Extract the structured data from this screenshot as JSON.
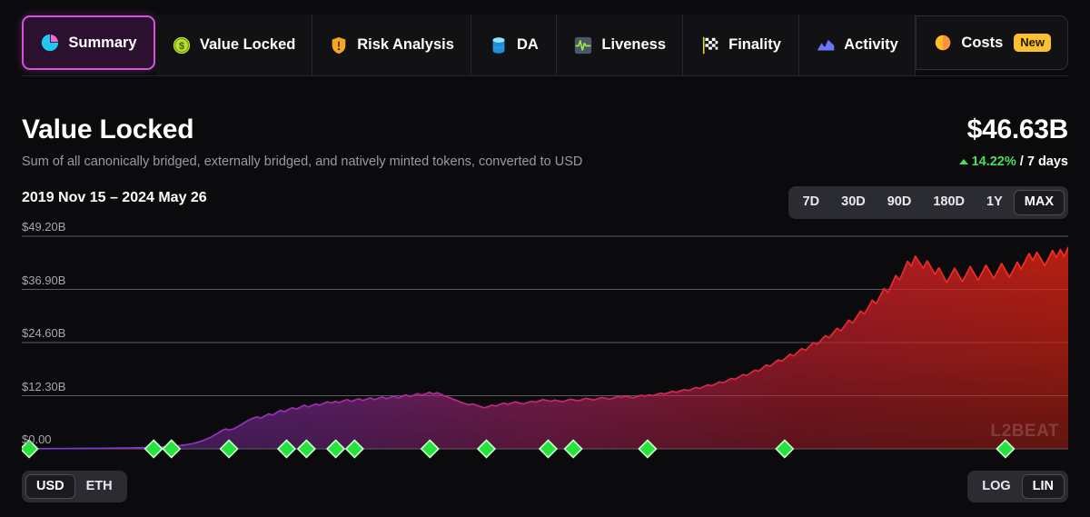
{
  "tabs": [
    {
      "label": "Summary",
      "icon": "pie-chart-icon",
      "active": true,
      "badge": null
    },
    {
      "label": "Value Locked",
      "icon": "dollar-coin-icon",
      "active": false,
      "badge": null
    },
    {
      "label": "Risk Analysis",
      "icon": "shield-warning-icon",
      "active": false,
      "badge": null
    },
    {
      "label": "DA",
      "icon": "database-icon",
      "active": false,
      "badge": null
    },
    {
      "label": "Liveness",
      "icon": "pulse-icon",
      "active": false,
      "badge": null
    },
    {
      "label": "Finality",
      "icon": "checkered-flag-icon",
      "active": false,
      "badge": null
    },
    {
      "label": "Activity",
      "icon": "area-chart-icon",
      "active": false,
      "badge": null
    },
    {
      "label": "Costs",
      "icon": "orange-circle-icon",
      "active": false,
      "badge": "New"
    }
  ],
  "header": {
    "title": "Value Locked",
    "subtitle": "Sum of all canonically bridged, externally bridged, and natively minted tokens, converted to USD",
    "value": "$46.63B",
    "change_pct": "14.22%",
    "change_period": "/ 7 days",
    "change_direction": "up",
    "change_color": "#4ade5c"
  },
  "controls": {
    "date_range": "2019 Nov 15 – 2024 May 26",
    "ranges": [
      "7D",
      "30D",
      "90D",
      "180D",
      "1Y",
      "MAX"
    ],
    "range_selected": "MAX",
    "currency": [
      "USD",
      "ETH"
    ],
    "currency_selected": "USD",
    "scale": [
      "LOG",
      "LIN"
    ],
    "scale_selected": "LIN",
    "watermark": "L2BEAT"
  },
  "chart_data": {
    "type": "area",
    "title": "Value Locked",
    "xlabel": "",
    "ylabel": "USD",
    "ylim": [
      0,
      49.2
    ],
    "ytick_labels": [
      "$49.20B",
      "$36.90B",
      "$24.60B",
      "$12.30B",
      "$0.00"
    ],
    "ytick_values": [
      49.2,
      36.9,
      24.6,
      12.3,
      0
    ],
    "grid": true,
    "legend": "none",
    "x_start": "2019 Nov 15",
    "x_end": "2024 May 26",
    "series": [
      {
        "name": "Value Locked (USD)",
        "gradient_start_color": "#8b3bd6",
        "gradient_mid_color": "#c0297a",
        "gradient_end_color": "#ff2a18",
        "values": [
          0.02,
          0.02,
          0.03,
          0.03,
          0.04,
          0.04,
          0.05,
          0.05,
          0.06,
          0.06,
          0.07,
          0.07,
          0.08,
          0.08,
          0.09,
          0.1,
          0.1,
          0.11,
          0.12,
          0.12,
          0.13,
          0.14,
          0.15,
          0.16,
          0.17,
          0.18,
          0.19,
          0.2,
          0.22,
          0.24,
          0.26,
          0.28,
          0.3,
          0.33,
          0.36,
          0.4,
          0.44,
          0.5,
          0.56,
          0.64,
          0.72,
          0.82,
          0.95,
          1.1,
          1.3,
          1.55,
          1.85,
          2.2,
          2.6,
          3.1,
          3.6,
          4.2,
          4.6,
          4.35,
          4.6,
          5.1,
          5.6,
          6.2,
          6.7,
          7.1,
          7.4,
          7.1,
          7.6,
          8.1,
          7.8,
          8.4,
          8.9,
          8.6,
          9.1,
          9.5,
          9.2,
          9.6,
          10.1,
          9.7,
          10.0,
          10.4,
          10.1,
          10.5,
          10.9,
          10.6,
          11.0,
          10.7,
          11.1,
          11.4,
          11.0,
          11.3,
          11.6,
          11.2,
          11.5,
          11.8,
          11.4,
          11.7,
          12.0,
          11.6,
          11.9,
          12.2,
          11.8,
          12.1,
          12.5,
          12.1,
          12.4,
          12.8,
          12.4,
          12.7,
          13.1,
          12.7,
          13.0,
          12.6,
          12.2,
          11.9,
          11.5,
          11.2,
          10.8,
          10.5,
          10.2,
          10.4,
          10.1,
          9.8,
          9.5,
          9.8,
          10.1,
          9.9,
          10.3,
          10.6,
          10.3,
          10.6,
          10.9,
          10.6,
          10.4,
          10.7,
          11.0,
          10.8,
          11.1,
          11.4,
          11.2,
          11.0,
          11.3,
          11.1,
          10.9,
          11.2,
          11.5,
          11.3,
          11.1,
          11.4,
          11.7,
          11.5,
          11.3,
          11.6,
          11.9,
          11.7,
          11.5,
          11.8,
          12.1,
          11.9,
          12.2,
          12.0,
          11.8,
          12.1,
          12.4,
          12.2,
          12.5,
          12.3,
          12.6,
          12.9,
          12.7,
          13.0,
          13.3,
          13.1,
          13.4,
          13.7,
          13.5,
          13.8,
          14.2,
          14.0,
          14.4,
          14.8,
          14.6,
          15.0,
          15.5,
          15.3,
          15.8,
          16.3,
          16.1,
          16.6,
          17.2,
          17.0,
          17.6,
          18.2,
          18.0,
          18.7,
          19.4,
          19.1,
          19.9,
          20.6,
          20.3,
          21.1,
          21.9,
          21.5,
          22.4,
          23.2,
          22.8,
          23.7,
          24.6,
          24.2,
          25.2,
          26.2,
          25.7,
          26.8,
          27.9,
          27.3,
          28.5,
          29.8,
          29.1,
          30.5,
          31.9,
          31.2,
          32.8,
          34.4,
          33.6,
          35.3,
          37.1,
          36.2,
          38.1,
          40.1,
          39.1,
          41.2,
          43.4,
          42.3,
          44.6,
          43.2,
          41.8,
          43.5,
          42.0,
          40.4,
          41.9,
          40.2,
          38.5,
          40.1,
          41.8,
          40.3,
          38.7,
          40.4,
          42.2,
          40.6,
          39.0,
          40.7,
          42.5,
          41.0,
          39.4,
          41.1,
          42.9,
          41.3,
          39.7,
          41.4,
          43.2,
          41.6,
          43.4,
          45.2,
          43.6,
          45.5,
          44.0,
          42.4,
          44.1,
          45.9,
          44.3,
          46.1,
          44.5,
          46.63
        ]
      }
    ],
    "markers": {
      "name": "milestone-marker",
      "shape": "diamond",
      "color": "#27e23c",
      "stroke": "#ffffff",
      "x_positions_pct": [
        0.7,
        12.6,
        14.3,
        19.8,
        25.3,
        27.2,
        30.0,
        31.8,
        39.0,
        44.4,
        50.3,
        52.7,
        59.8,
        72.9,
        94.0
      ]
    }
  }
}
